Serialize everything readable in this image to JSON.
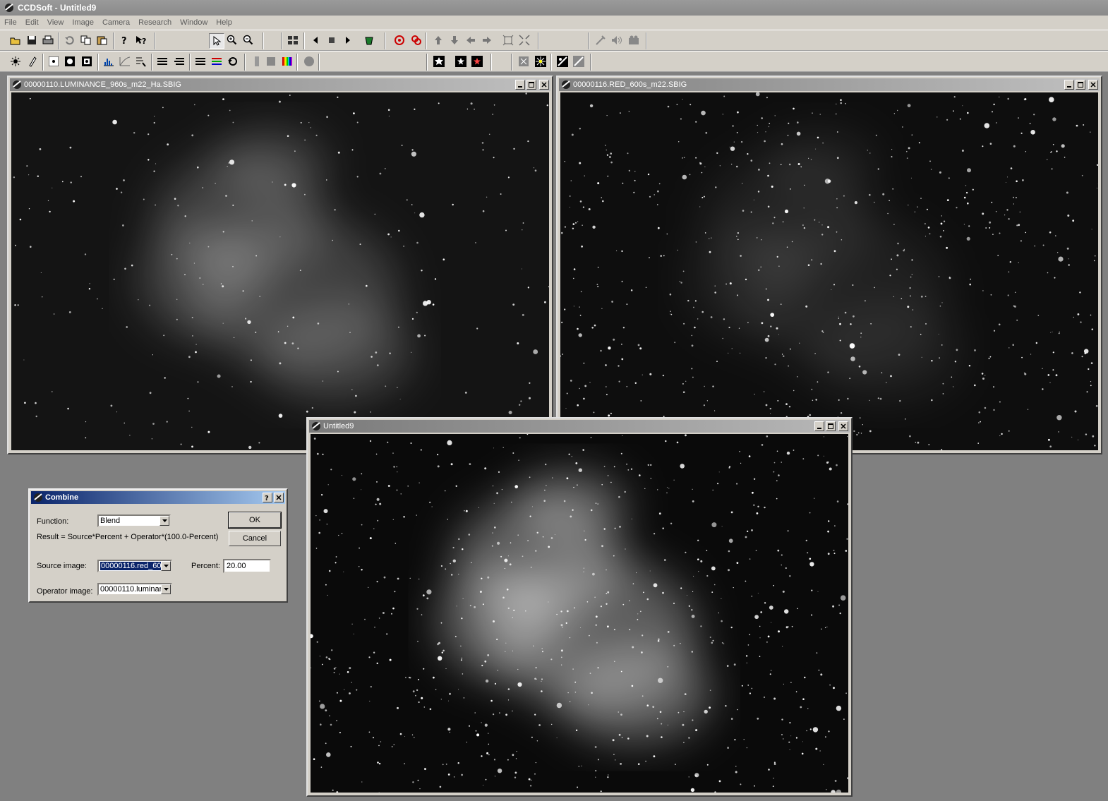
{
  "app": {
    "title": "CCDSoft  - Untitled9"
  },
  "menu": [
    "File",
    "Edit",
    "View",
    "Image",
    "Camera",
    "Research",
    "Window",
    "Help"
  ],
  "windows": {
    "luminance": {
      "title": "00000110.LUMINANCE_960s_m22_Ha.SBIG"
    },
    "red": {
      "title": "00000116.RED_600s_m22.SBIG"
    },
    "result": {
      "title": "Untitled9"
    }
  },
  "dialog": {
    "title": "Combine",
    "function_label": "Function:",
    "function_value": "Blend",
    "formula": "Result =  Source*Percent + Operator*(100.0-Percent)",
    "source_label": "Source image:",
    "source_value": "00000116.red_60",
    "operator_label": "Operator image:",
    "operator_value": "00000110.luminar",
    "percent_label": "Percent:",
    "percent_value": "20.00",
    "ok_label": "OK",
    "cancel_label": "Cancel"
  },
  "icons": {
    "toolbar1": [
      "open-icon",
      "save-icon",
      "print-icon",
      "undo-icon",
      "copy-icon",
      "paste-icon",
      "help-icon",
      "context-help-icon",
      "pointer-icon",
      "zoom-in-icon",
      "zoom-out-icon",
      "tile-icon",
      "prev-icon",
      "stop-icon",
      "next-icon",
      "bucket-icon",
      "target-icon",
      "double-target-icon",
      "up-arrow-icon",
      "down-arrow-icon",
      "left-arrow-icon",
      "right-arrow-icon",
      "crop-icon",
      "resize-icon",
      "tool-icon",
      "sound-icon",
      "camera-icon"
    ],
    "toolbar2": [
      "brightness-icon",
      "tube-icon",
      "dot-icon",
      "spot-icon",
      "square-spot-icon",
      "histogram-icon",
      "curve-icon",
      "levels-icon",
      "stack-icon",
      "align-icon",
      "stack2-icon",
      "color-stack-icon",
      "rotate-icon",
      "gray-bar-icon",
      "gray-square-icon",
      "rainbow-icon",
      "circle-icon",
      "star-enhance-icon",
      "star-square-icon",
      "red-star-icon",
      "x-square-icon",
      "sparkle-icon",
      "diag-icon",
      "diag2-icon"
    ]
  }
}
